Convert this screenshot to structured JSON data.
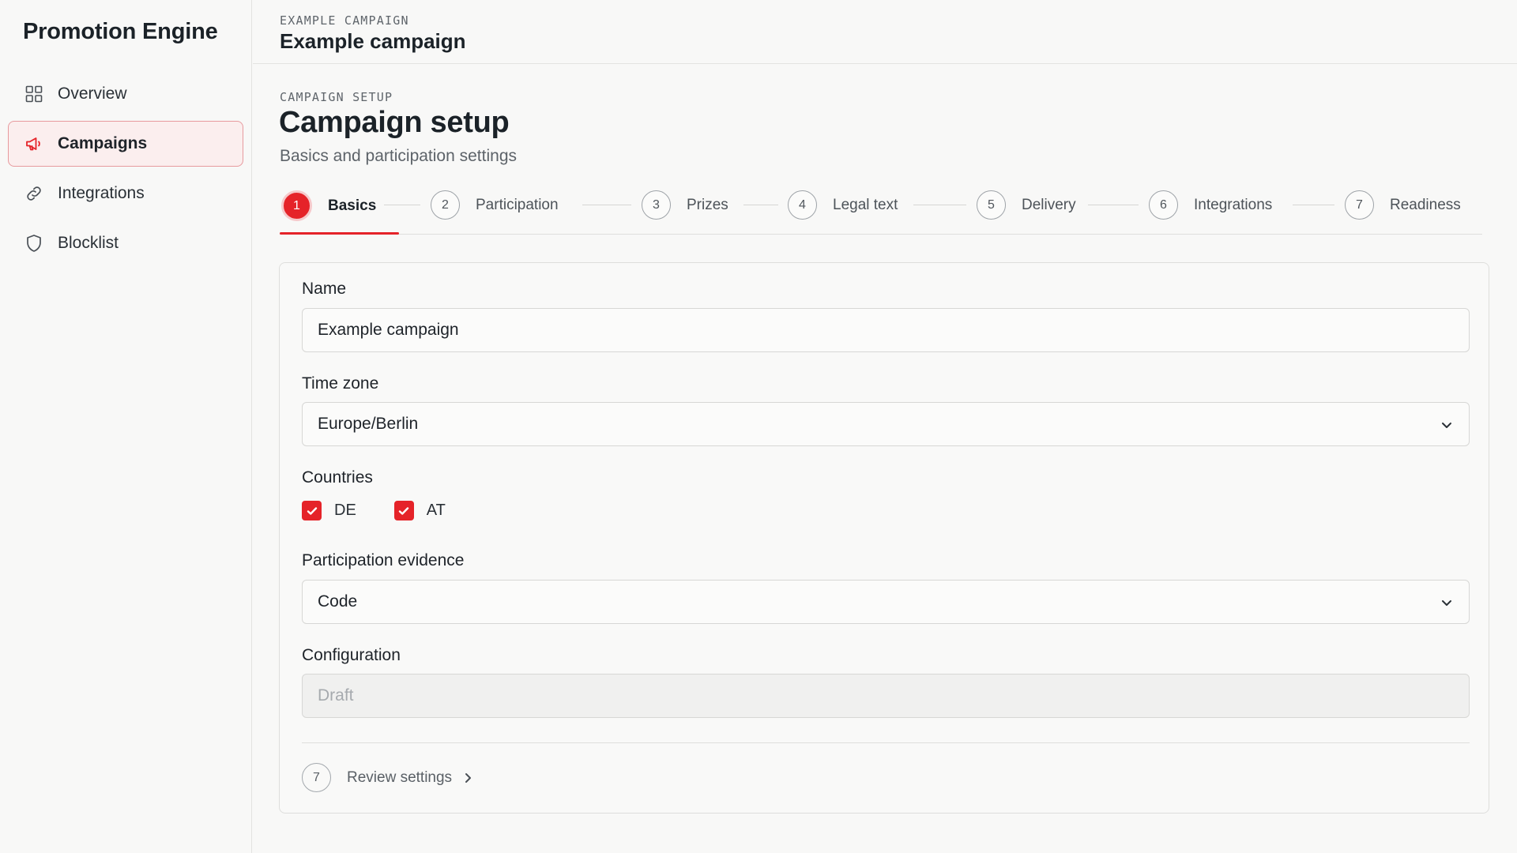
{
  "app": {
    "brand": "Promotion Engine"
  },
  "sidebar": {
    "items": [
      {
        "label": "Overview",
        "icon": "grid-icon"
      },
      {
        "label": "Campaigns",
        "icon": "megaphone-icon",
        "active": true
      },
      {
        "label": "Integrations",
        "icon": "link-icon"
      },
      {
        "label": "Blocklist",
        "icon": "shield-icon"
      }
    ]
  },
  "header": {
    "eyebrow": "EXAMPLE CAMPAIGN",
    "title": "Example campaign"
  },
  "page": {
    "eyebrow": "CAMPAIGN SETUP",
    "title": "Campaign setup",
    "subtitle": "Basics and participation settings"
  },
  "stepper": {
    "steps": [
      {
        "number": "1",
        "label": "Basics",
        "active": true
      },
      {
        "number": "2",
        "label": "Participation"
      },
      {
        "number": "3",
        "label": "Prizes"
      },
      {
        "number": "4",
        "label": "Legal text"
      },
      {
        "number": "5",
        "label": "Delivery"
      },
      {
        "number": "6",
        "label": "Integrations"
      },
      {
        "number": "7",
        "label": "Readiness"
      }
    ]
  },
  "form": {
    "name_label": "Name",
    "name_value": "Example campaign",
    "timezone_label": "Time zone",
    "timezone_value": "Europe/Berlin",
    "countries_label": "Countries",
    "countries": [
      {
        "code": "DE",
        "checked": true
      },
      {
        "code": "AT",
        "checked": true
      }
    ],
    "evidence_label": "Participation evidence",
    "evidence_value": "Code",
    "configuration_label": "Configuration",
    "configuration_value": "Draft"
  },
  "footer": {
    "review_number": "7",
    "review_label": "Review settings"
  },
  "colors": {
    "accent": "#e52329",
    "accent_soft": "#fbeeee"
  }
}
